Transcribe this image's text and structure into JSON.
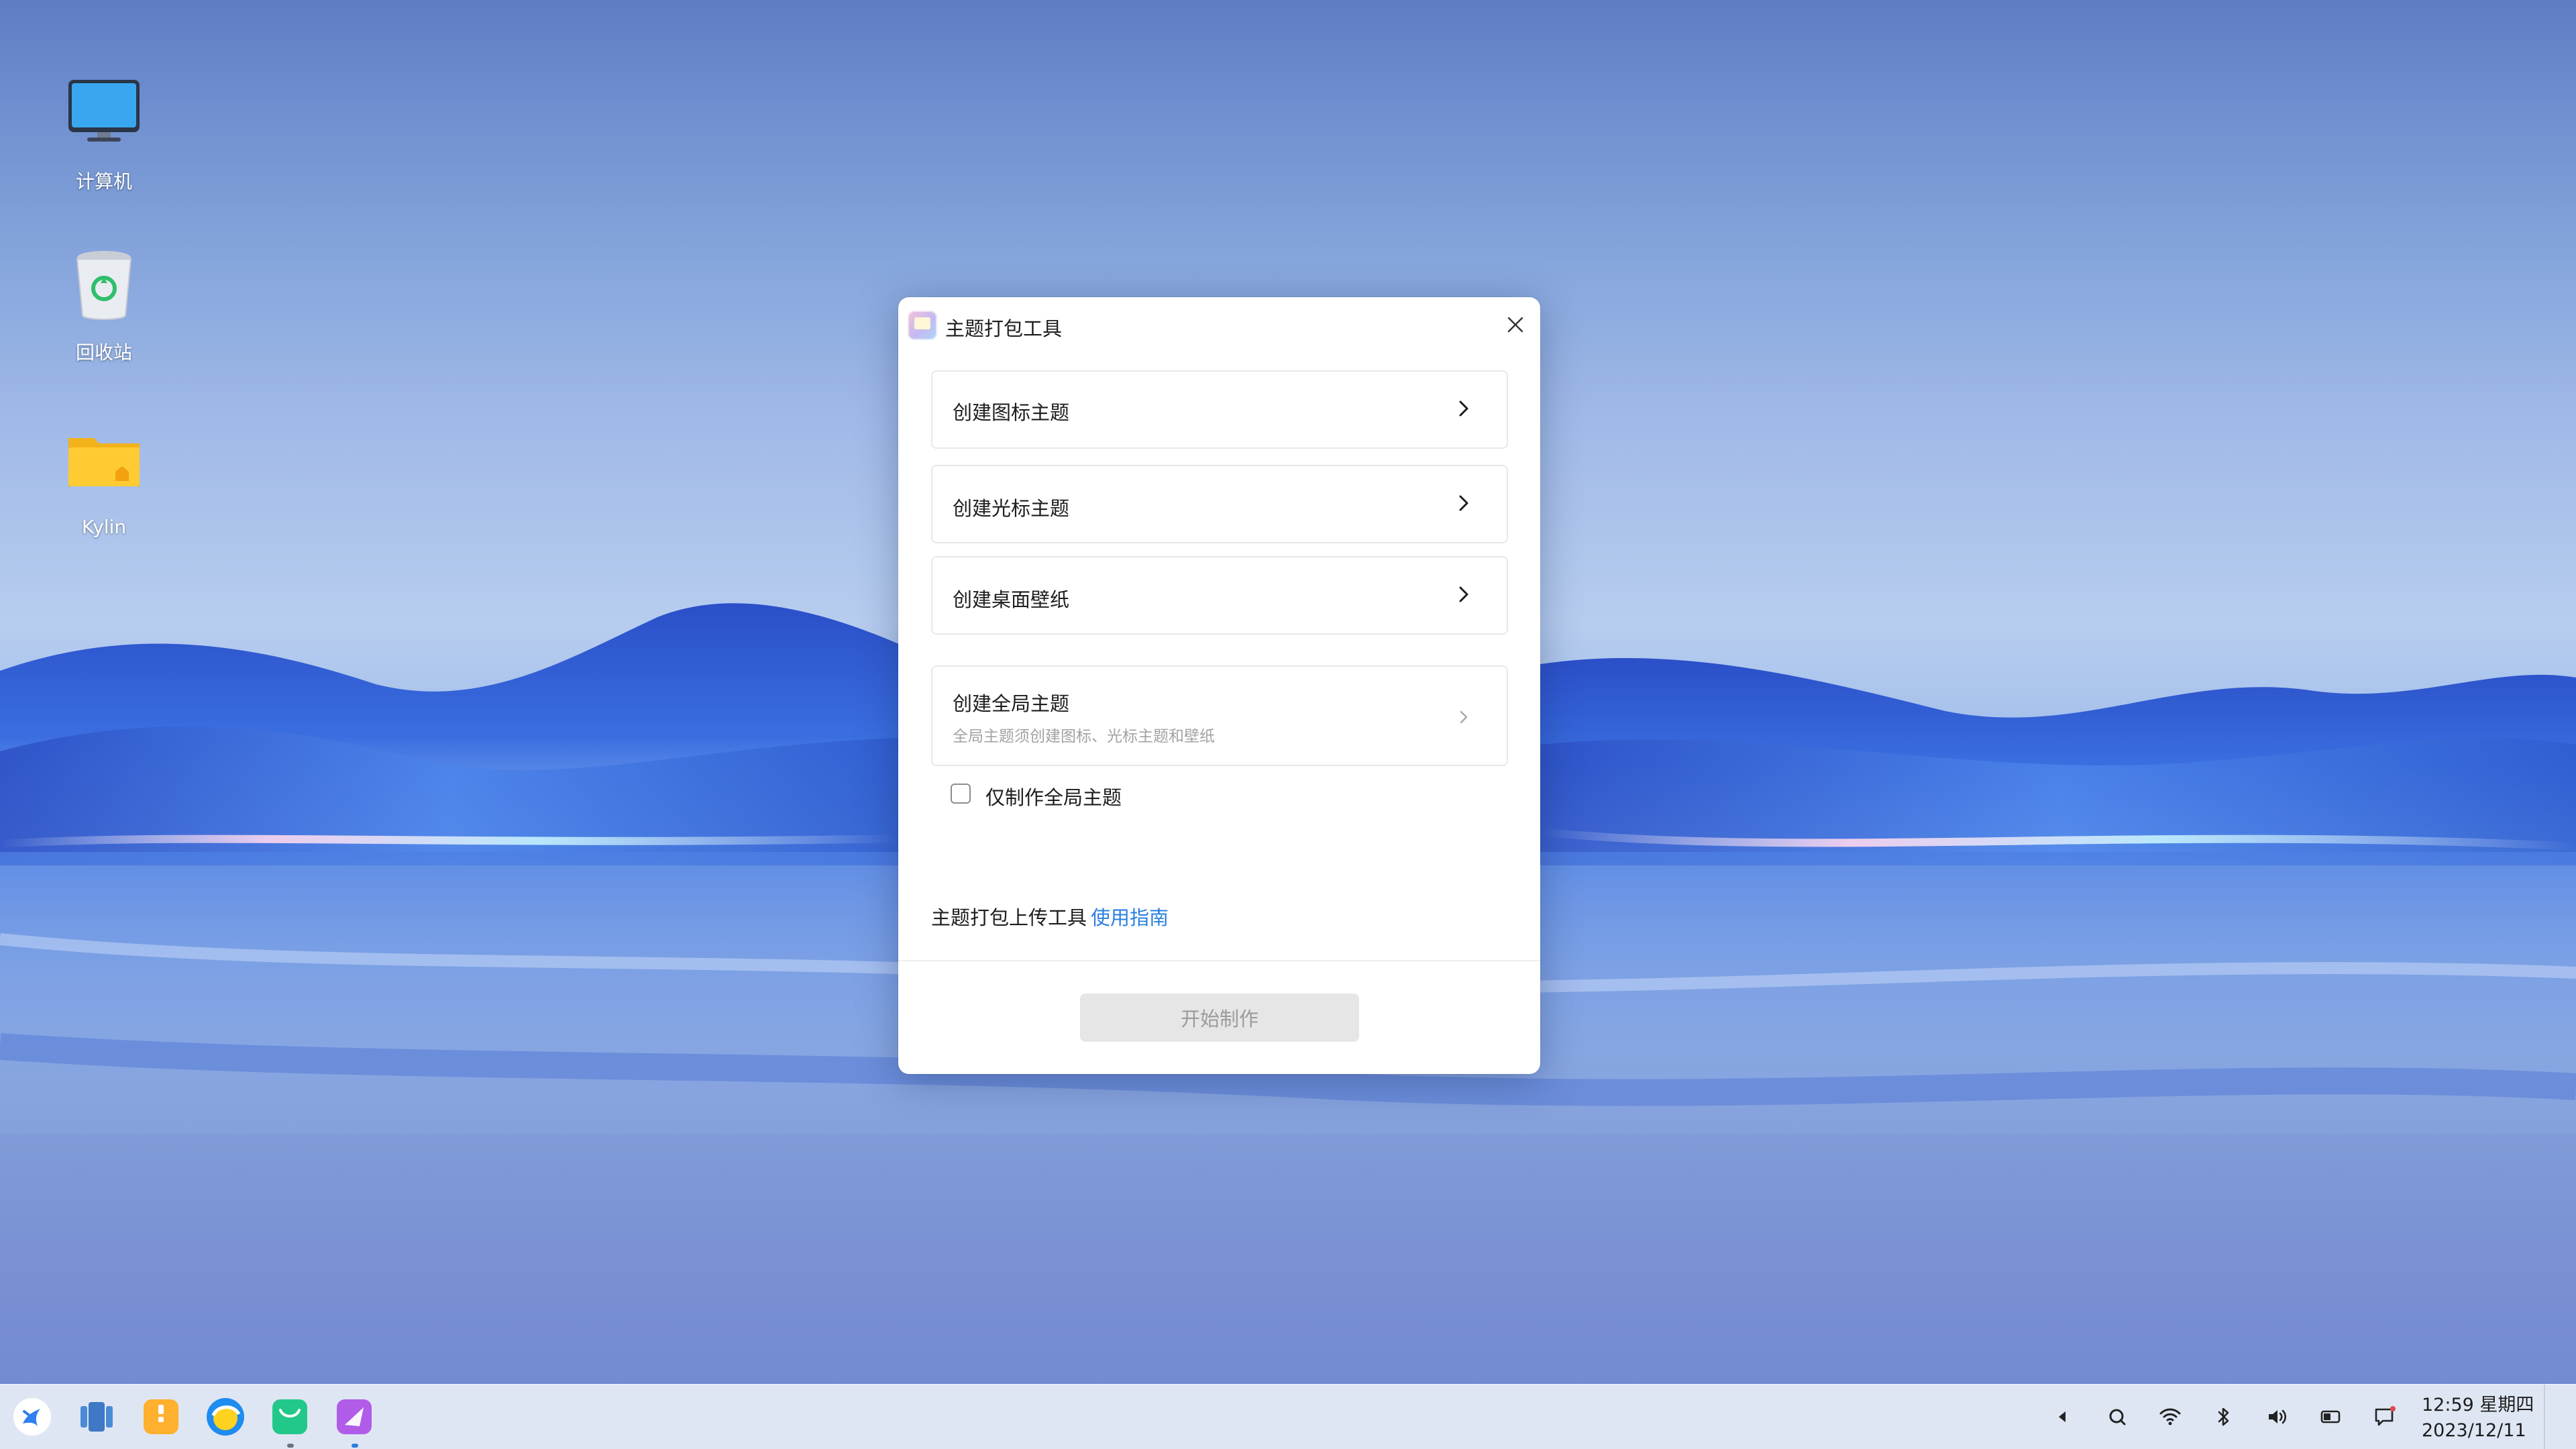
{
  "desktop": {
    "icons": [
      {
        "label": "计算机",
        "icon": "computer-icon"
      },
      {
        "label": "回收站",
        "icon": "trash-icon"
      },
      {
        "label": "Kylin",
        "icon": "home-folder-icon"
      }
    ]
  },
  "dialog": {
    "title": "主题打包工具",
    "options": [
      {
        "label": "创建图标主题"
      },
      {
        "label": "创建光标主题"
      },
      {
        "label": "创建桌面壁纸"
      },
      {
        "label": "创建全局主题",
        "sublabel": "全局主题须创建图标、光标主题和壁纸"
      }
    ],
    "checkbox_label": "仅制作全局主题",
    "checkbox_checked": false,
    "upload_text": "主题打包上传工具",
    "guide_link": "使用指南",
    "start_button": "开始制作"
  },
  "taskbar": {
    "apps": [
      "start-menu-icon",
      "multitask-view-icon",
      "file-manager-icon",
      "browser-icon",
      "software-store-icon",
      "theme-tool-icon"
    ],
    "tray": [
      "arrow-left-icon",
      "search-icon",
      "wifi-icon",
      "bluetooth-icon",
      "volume-icon",
      "battery-icon",
      "notification-icon"
    ],
    "time": "12:59 星期四",
    "date": "2023/12/11"
  },
  "colors": {
    "accent": "#2a7fe0",
    "taskbar_bg": "#dee5f3",
    "button_disabled_bg": "#e6e6e6"
  }
}
